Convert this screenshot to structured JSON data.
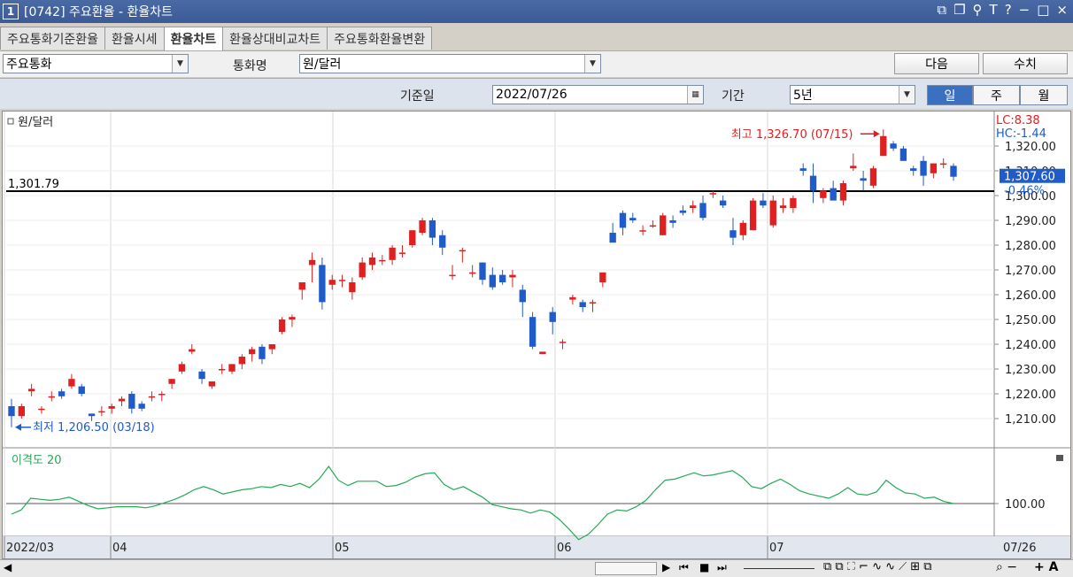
{
  "titlebar": {
    "num": "1",
    "title": "[0742] 주요환율 - 환율차트"
  },
  "tabs": [
    "주요통화기준환율",
    "환율시세",
    "환율차트",
    "환율상대비교차트",
    "주요통화환율변환"
  ],
  "toolbar": {
    "currency_group": "주요통화",
    "currency_label": "통화명",
    "currency_value": "원/달러",
    "next_button": "다음",
    "value_button": "수치",
    "base_date_label": "기준일",
    "base_date": "2022/07/26",
    "period_label": "기간",
    "period_value": "5년",
    "periods": [
      "일",
      "주",
      "월"
    ]
  },
  "chart": {
    "legend": "원/달러",
    "hline_label": "1,301.79",
    "max_annot": "최고 1,326.70 (07/15)",
    "min_annot": "최저 1,206.50 (03/18)",
    "lc_label": "LC:8.38",
    "hc_label": "HC:-1.44",
    "current_price": "1,307.60",
    "current_change": "-0.46%",
    "y_ticks": [
      "1,320.00",
      "1,310.00",
      "1,300.00",
      "1,290.00",
      "1,280.00",
      "1,270.00",
      "1,260.00",
      "1,250.00",
      "1,240.00",
      "1,230.00",
      "1,220.00",
      "1,210.00"
    ],
    "indicator_label": "이격도 20",
    "indicator_tick": "100.00",
    "x_labels": [
      "2022/03",
      "04",
      "05",
      "06",
      "07"
    ],
    "x_right_label": "07/26"
  },
  "colors": {
    "up": "#e02020",
    "down": "#1f5bc9",
    "indicator": "#22aa55"
  },
  "chart_data": {
    "type": "candlestick",
    "series": [
      {
        "name": "원/달러",
        "ohlc": [
          [
            1215,
            1218,
            1206.5,
            1211
          ],
          [
            1211,
            1216,
            1210,
            1215
          ],
          [
            1221,
            1224,
            1219,
            1222
          ],
          [
            1214,
            1215,
            1212,
            1214
          ],
          [
            1219,
            1221,
            1217,
            1219
          ],
          [
            1221,
            1222,
            1218,
            1219
          ],
          [
            1223,
            1228,
            1222,
            1226
          ],
          [
            1223,
            1224,
            1219,
            1220
          ],
          [
            1212,
            1212,
            1209,
            1211
          ],
          [
            1213,
            1215,
            1211,
            1213
          ],
          [
            1214,
            1216,
            1212,
            1215
          ],
          [
            1217,
            1219,
            1215,
            1218
          ],
          [
            1220,
            1221,
            1212,
            1214
          ],
          [
            1216,
            1217,
            1213,
            1214
          ],
          [
            1219,
            1221,
            1217,
            1219
          ],
          [
            1220,
            1221,
            1217,
            1220
          ],
          [
            1224,
            1226,
            1222,
            1226
          ],
          [
            1229,
            1233,
            1228,
            1232
          ],
          [
            1237,
            1240,
            1236,
            1238
          ],
          [
            1229,
            1230,
            1224,
            1226
          ],
          [
            1223,
            1225,
            1222,
            1225
          ],
          [
            1230,
            1232,
            1228,
            1230
          ],
          [
            1229,
            1232,
            1228,
            1232
          ],
          [
            1232,
            1236,
            1230,
            1235
          ],
          [
            1236,
            1239,
            1233,
            1238
          ],
          [
            1239,
            1240,
            1232,
            1234
          ],
          [
            1238,
            1240,
            1236,
            1240
          ],
          [
            1245,
            1251,
            1244,
            1250
          ],
          [
            1250,
            1252,
            1247,
            1251
          ],
          [
            1262,
            1264,
            1258,
            1265
          ],
          [
            1272,
            1277,
            1265,
            1274
          ],
          [
            1272,
            1275,
            1254,
            1257
          ],
          [
            1264,
            1268,
            1262,
            1266
          ],
          [
            1266,
            1268,
            1263,
            1266
          ],
          [
            1261,
            1267,
            1258,
            1265
          ],
          [
            1267,
            1275,
            1266,
            1273
          ],
          [
            1272,
            1277,
            1270,
            1275
          ],
          [
            1274,
            1276,
            1272,
            1274
          ],
          [
            1274,
            1280,
            1272,
            1279
          ],
          [
            1277,
            1280,
            1275,
            1277
          ],
          [
            1280,
            1286,
            1279,
            1286
          ],
          [
            1285,
            1291,
            1284,
            1290
          ],
          [
            1290,
            1291,
            1280,
            1283
          ],
          [
            1284,
            1286,
            1276,
            1279
          ],
          [
            1268,
            1272,
            1266,
            1268
          ],
          [
            1278,
            1279,
            1273,
            1278
          ],
          [
            1269,
            1272,
            1267,
            1269
          ],
          [
            1273,
            1273,
            1264,
            1266
          ],
          [
            1268,
            1271,
            1262,
            1263
          ],
          [
            1268,
            1270,
            1264,
            1265
          ],
          [
            1267,
            1270,
            1263,
            1268
          ],
          [
            1262,
            1264,
            1251,
            1257
          ],
          [
            1251,
            1253,
            1238,
            1239
          ],
          [
            1236,
            1237,
            1236,
            1237
          ],
          [
            1253,
            1255,
            1244,
            1249
          ],
          [
            1241,
            1242,
            1238,
            1241
          ],
          [
            1258,
            1260,
            1256,
            1259
          ],
          [
            1257,
            1258,
            1253,
            1255
          ],
          [
            1257,
            1258,
            1253,
            1257
          ],
          [
            1265,
            1266,
            1263,
            1269
          ],
          [
            1285,
            1289,
            1283,
            1281
          ],
          [
            1293,
            1294,
            1284,
            1287
          ],
          [
            1291,
            1293,
            1289,
            1290
          ],
          [
            1286,
            1288,
            1284,
            1286
          ],
          [
            1288,
            1290,
            1287,
            1288
          ],
          [
            1284,
            1293,
            1284,
            1292
          ],
          [
            1290,
            1292,
            1287,
            1289
          ],
          [
            1294,
            1296,
            1292,
            1293
          ],
          [
            1295,
            1298,
            1293,
            1296
          ],
          [
            1297,
            1300,
            1290,
            1291
          ],
          [
            1301,
            1302,
            1299,
            1301
          ],
          [
            1298,
            1300,
            1295,
            1296
          ],
          [
            1286,
            1291,
            1280,
            1283
          ],
          [
            1284,
            1290,
            1282,
            1289
          ],
          [
            1286,
            1299,
            1286,
            1298
          ],
          [
            1298,
            1301,
            1295,
            1296
          ],
          [
            1288,
            1300,
            1287,
            1298
          ],
          [
            1295,
            1299,
            1293,
            1296
          ],
          [
            1295,
            1300,
            1293,
            1299
          ],
          [
            1311,
            1313,
            1308,
            1310
          ],
          [
            1308,
            1313,
            1297,
            1302
          ],
          [
            1299,
            1303,
            1297,
            1302
          ],
          [
            1303,
            1306,
            1299,
            1298
          ],
          [
            1298,
            1306,
            1296,
            1305
          ],
          [
            1311,
            1317,
            1310,
            1312
          ],
          [
            1307,
            1310,
            1302,
            1306
          ],
          [
            1304,
            1312,
            1303,
            1311
          ],
          [
            1316,
            1326.7,
            1316,
            1324
          ],
          [
            1321,
            1322,
            1318,
            1319
          ],
          [
            1319,
            1320,
            1314,
            1314
          ],
          [
            1311,
            1312,
            1308,
            1310
          ],
          [
            1314,
            1316,
            1304,
            1308
          ],
          [
            1309,
            1313,
            1307,
            1313
          ],
          [
            1313,
            1315,
            1311,
            1313
          ],
          [
            1312,
            1313,
            1306,
            1307.6
          ]
        ]
      }
    ],
    "x_labels": [
      "2022/03",
      "04",
      "05",
      "06",
      "07"
    ],
    "ylim": [
      1200,
      1330
    ],
    "reference_line": 1301.79,
    "indicator": {
      "name": "이격도 20",
      "reference": 100,
      "values": [
        99.0,
        99.4,
        100.5,
        100.4,
        100.3,
        100.4,
        100.6,
        100.2,
        99.8,
        99.5,
        99.6,
        99.7,
        99.7,
        99.7,
        99.6,
        99.8,
        100.1,
        100.4,
        100.8,
        101.3,
        101.6,
        101.3,
        100.9,
        101.1,
        101.3,
        101.4,
        101.6,
        101.5,
        101.8,
        101.6,
        101.9,
        101.5,
        102.3,
        103.5,
        102.2,
        101.7,
        102.1,
        102.1,
        102.1,
        101.6,
        101.7,
        102.0,
        102.5,
        102.8,
        102.9,
        101.8,
        101.3,
        101.6,
        101.1,
        100.6,
        99.9,
        99.7,
        99.5,
        99.4,
        99.1,
        99.4,
        99.2,
        98.5,
        97.6,
        96.6,
        97.1,
        98.0,
        99.0,
        99.4,
        99.3,
        99.7,
        100.3,
        101.3,
        102.2,
        102.3,
        102.6,
        102.9,
        102.6,
        102.7,
        102.9,
        103.1,
        102.5,
        101.6,
        101.4,
        101.9,
        102.3,
        101.8,
        101.2,
        100.9,
        100.7,
        100.5,
        100.9,
        101.5,
        100.9,
        100.8,
        101.1,
        102.2,
        101.5,
        101.0,
        100.9,
        100.5,
        100.6,
        100.2,
        100.0
      ]
    }
  }
}
